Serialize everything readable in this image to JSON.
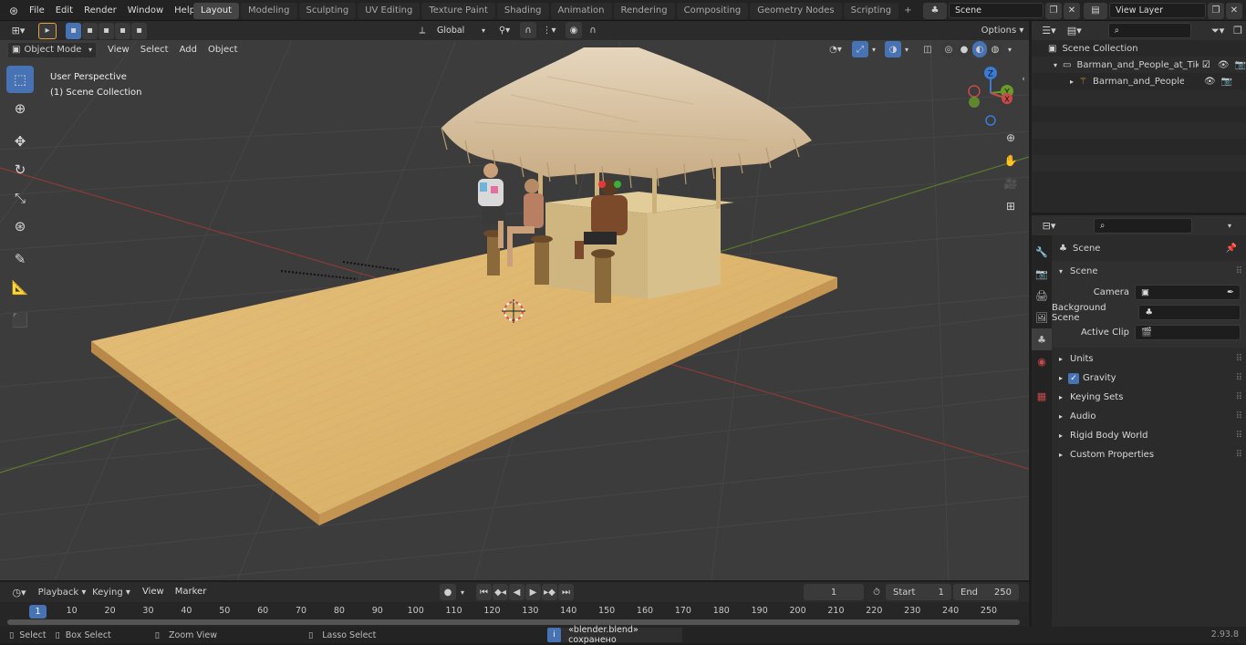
{
  "menu": {
    "items": [
      "File",
      "Edit",
      "Render",
      "Window",
      "Help"
    ],
    "workspaces": [
      "Layout",
      "Modeling",
      "Sculpting",
      "UV Editing",
      "Texture Paint",
      "Shading",
      "Animation",
      "Rendering",
      "Compositing",
      "Geometry Nodes",
      "Scripting"
    ],
    "active_workspace": "Layout",
    "add_workspace": "+"
  },
  "scene_field": "Scene",
  "view_layer_field": "View Layer",
  "viewport": {
    "mode": "Object Mode",
    "menus": [
      "View",
      "Select",
      "Add",
      "Object"
    ],
    "transform_orientation": "Global",
    "options_label": "Options",
    "overlay_line1": "User Perspective",
    "overlay_line2": "(1) Scene Collection",
    "gizmo_axes": [
      "X",
      "Y",
      "Z"
    ]
  },
  "outliner": {
    "root": "Scene Collection",
    "collection": "Barman_and_People_at_Tiki_",
    "object": "Barman_and_People_at_"
  },
  "properties": {
    "context": "Scene",
    "section": "Scene",
    "fields": [
      {
        "label": "Camera",
        "icon": "camera-icon"
      },
      {
        "label": "Background Scene",
        "icon": "scene-icon"
      },
      {
        "label": "Active Clip",
        "icon": "clip-icon"
      }
    ],
    "panels": [
      "Units",
      "Gravity",
      "Keying Sets",
      "Audio",
      "Rigid Body World",
      "Custom Properties"
    ]
  },
  "timeline": {
    "menus": [
      "Playback",
      "Keying",
      "View",
      "Marker"
    ],
    "current_frame": "1",
    "start_label": "Start",
    "start_value": "1",
    "end_label": "End",
    "end_value": "250",
    "ticks": [
      "10",
      "20",
      "30",
      "40",
      "50",
      "60",
      "70",
      "80",
      "90",
      "100",
      "110",
      "120",
      "130",
      "140",
      "150",
      "160",
      "170",
      "180",
      "190",
      "200",
      "210",
      "220",
      "230",
      "240",
      "250"
    ],
    "playhead_label": "1"
  },
  "status": {
    "select": "Select",
    "box_select": "Box Select",
    "zoom_view": "Zoom View",
    "lasso_select": "Lasso Select",
    "message": "«blender.blend» сохранено",
    "version": "2.93.8"
  },
  "colors": {
    "accent": "#4772b3",
    "x_axis": "#c64a4a",
    "y_axis": "#6a9a2a",
    "z_axis": "#3a7bd5",
    "deck": "#d9ad66",
    "thatch": "#d8c3a4"
  }
}
